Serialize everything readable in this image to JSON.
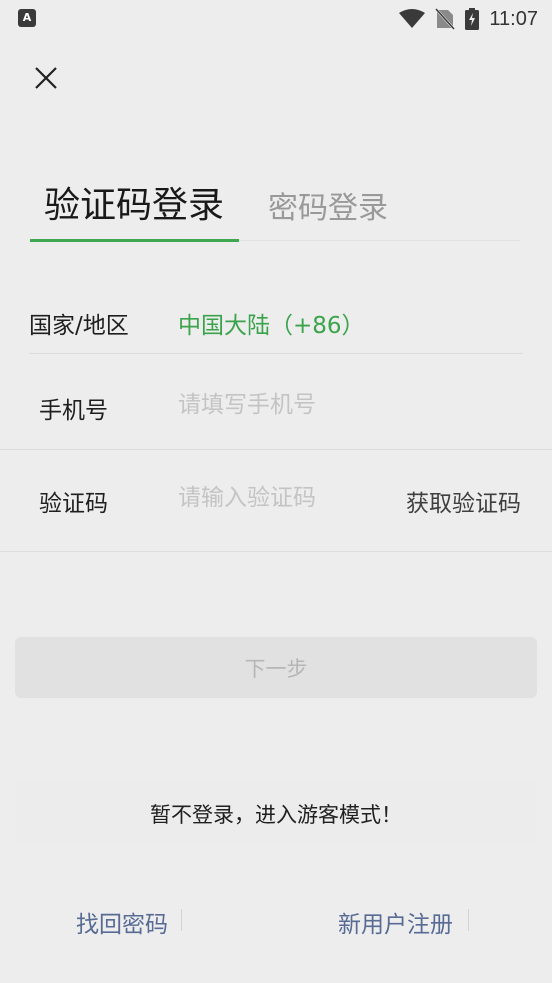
{
  "status_bar": {
    "time": "11:07",
    "app_badge": "A"
  },
  "tabs": {
    "active": "验证码登录",
    "inactive": "密码登录"
  },
  "form": {
    "country_label": "国家/地区",
    "country_value": "中国大陆（+86）",
    "phone_label": "手机号",
    "phone_placeholder": "请填写手机号",
    "code_label": "验证码",
    "code_placeholder": "请输入验证码",
    "get_code": "获取验证码"
  },
  "next_button": "下一步",
  "guest_button": "暂不登录，进入游客模式！",
  "footer": {
    "forgot_password": "找回密码",
    "register": "新用户注册"
  },
  "colors": {
    "accent": "#3fa750",
    "link": "#576b95",
    "background": "#ededed"
  }
}
